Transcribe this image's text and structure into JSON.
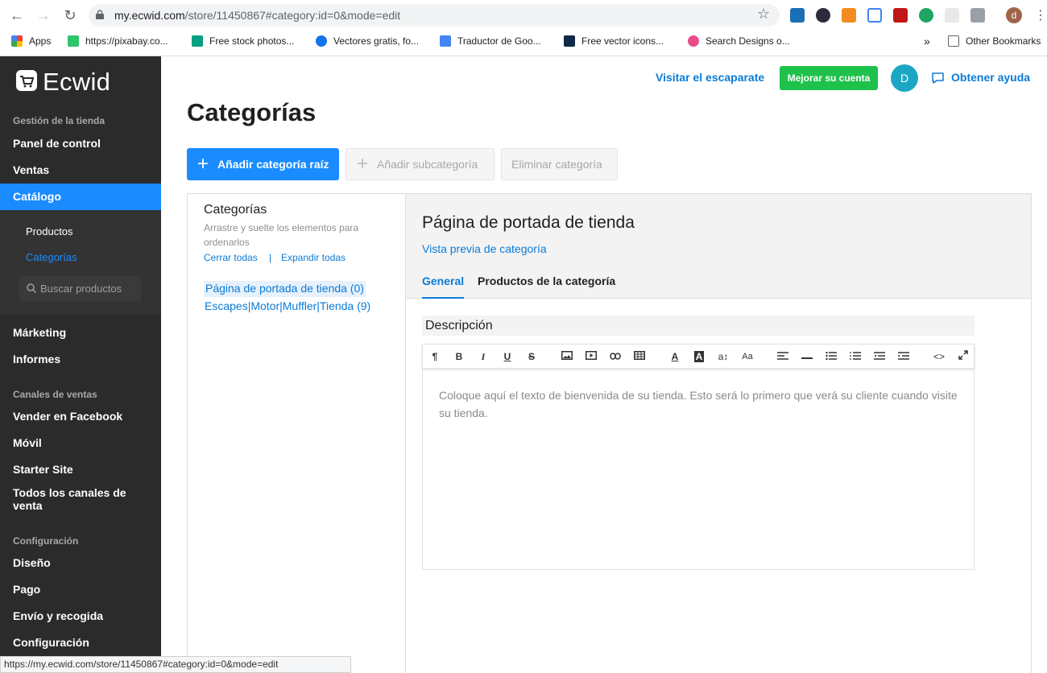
{
  "browser": {
    "url_host": "my.ecwid.com",
    "url_path": "/store/11450867#category:id=0&mode=edit",
    "profile_initial": "d",
    "bookmarks": [
      {
        "label": "Apps",
        "icon": "apps-grid-icon",
        "color": "#4285f4"
      },
      {
        "label": "https://pixabay.co...",
        "icon": "pixabay-icon",
        "color": "#2ec66d"
      },
      {
        "label": "Free stock photos...",
        "icon": "pexels-icon",
        "color": "#05a081"
      },
      {
        "label": "Vectores gratis, fo...",
        "icon": "freepik-icon",
        "color": "#1273eb"
      },
      {
        "label": "Traductor de Goo...",
        "icon": "google-translate-icon",
        "color": "#4285f4"
      },
      {
        "label": "Free vector icons...",
        "icon": "flaticon-icon",
        "color": "#0e2a47"
      },
      {
        "label": "Search Designs o...",
        "icon": "dribbble-icon",
        "color": "#ea4c89"
      }
    ],
    "other_bookmarks": "Other Bookmarks",
    "overflow": "»"
  },
  "brand": {
    "name": "Ecwid"
  },
  "sidebar": {
    "section_store": "Gestión de la tienda",
    "items_store": [
      "Panel de control",
      "Ventas",
      "Catálogo"
    ],
    "catalog_sub": [
      "Productos",
      "Categorías"
    ],
    "search_placeholder": "Buscar productos",
    "items_store2": [
      "Márketing",
      "Informes"
    ],
    "section_channels": "Canales de ventas",
    "items_channels": [
      "Vender en Facebook",
      "Móvil",
      "Starter Site",
      "Todos los canales de venta"
    ],
    "section_config": "Configuración",
    "items_config": [
      "Diseño",
      "Pago",
      "Envío y recogida",
      "Configuración"
    ]
  },
  "topbar": {
    "visit": "Visitar el escaparate",
    "upgrade": "Mejorar su cuenta",
    "avatar": "D",
    "help": "Obtener ayuda"
  },
  "page": {
    "title": "Categorías",
    "btn_add_root": "Añadir categoría raíz",
    "btn_add_sub": "Añadir subcategoría",
    "btn_delete": "Eliminar categoría"
  },
  "tree": {
    "title": "Categorías",
    "hint": "Arrastre y suelte los elementos para ordenarlos",
    "collapse": "Cerrar todas",
    "sep": "|",
    "expand": "Expandir todas",
    "nodes": [
      "Página de portada de tienda (0)",
      "Escapes|Motor|Muffler|Tienda (9)"
    ]
  },
  "detail": {
    "title": "Página de portada de tienda",
    "preview": "Vista previa de categoría",
    "tabs": [
      "General",
      "Productos de la categoría"
    ],
    "desc_label": "Descripción",
    "editor_placeholder": "Coloque aquí el texto de bienvenida de su tienda. Esto será lo primero que verá su cliente cuando visite su tienda."
  },
  "status_url": "https://my.ecwid.com/store/11450867#category:id=0&mode=edit",
  "colors": {
    "accent": "#1a8cff",
    "upgrade": "#1ec24b",
    "sidebar": "#2b2b2b",
    "link": "#0a7bd6"
  }
}
